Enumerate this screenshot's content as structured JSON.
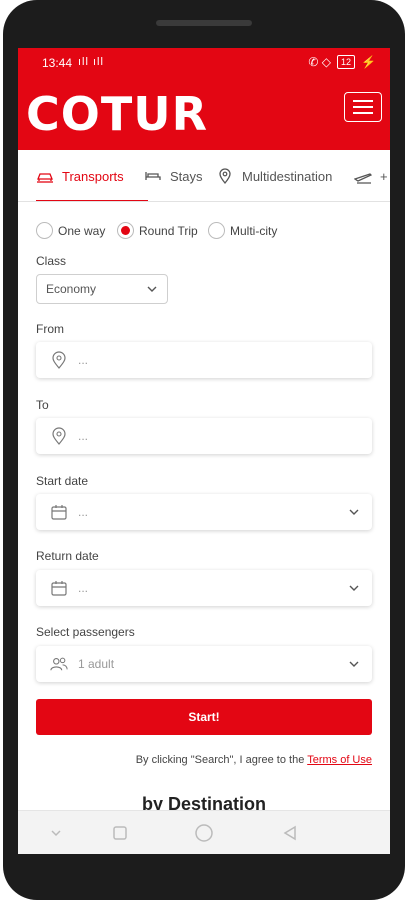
{
  "status_bar": {
    "time": "13:44",
    "left_icons": "ıll ıll",
    "right_icons": "✆ ◇",
    "battery": "12"
  },
  "header": {
    "logo": "COTUR",
    "menu_icon": "hamburger-icon"
  },
  "tabs": [
    {
      "label": "Transports",
      "icon": "car-icon",
      "active": true
    },
    {
      "label": "Stays",
      "icon": "bed-icon",
      "active": false
    },
    {
      "label": "Multidestination",
      "icon": "pin-icon",
      "active": false
    },
    {
      "label": "+",
      "icon": "plane-icon",
      "active": false
    }
  ],
  "trip_type": {
    "options": [
      "One way",
      "Round Trip",
      "Multi-city"
    ],
    "selected": "Round Trip"
  },
  "class": {
    "label": "Class",
    "value": "Economy"
  },
  "from": {
    "label": "From",
    "placeholder": "..."
  },
  "to": {
    "label": "To",
    "placeholder": "..."
  },
  "start_date": {
    "label": "Start date",
    "placeholder": "..."
  },
  "return_date": {
    "label": "Return date",
    "placeholder": "..."
  },
  "passengers": {
    "label": "Select passengers",
    "value": "1 adult"
  },
  "start_button": "Start!",
  "consent": {
    "text": "By clicking \"Search\", I agree to the ",
    "link": "Terms of Use"
  },
  "section_title": "by Destination",
  "colors": {
    "brand": "#e30613",
    "text": "#444444"
  }
}
